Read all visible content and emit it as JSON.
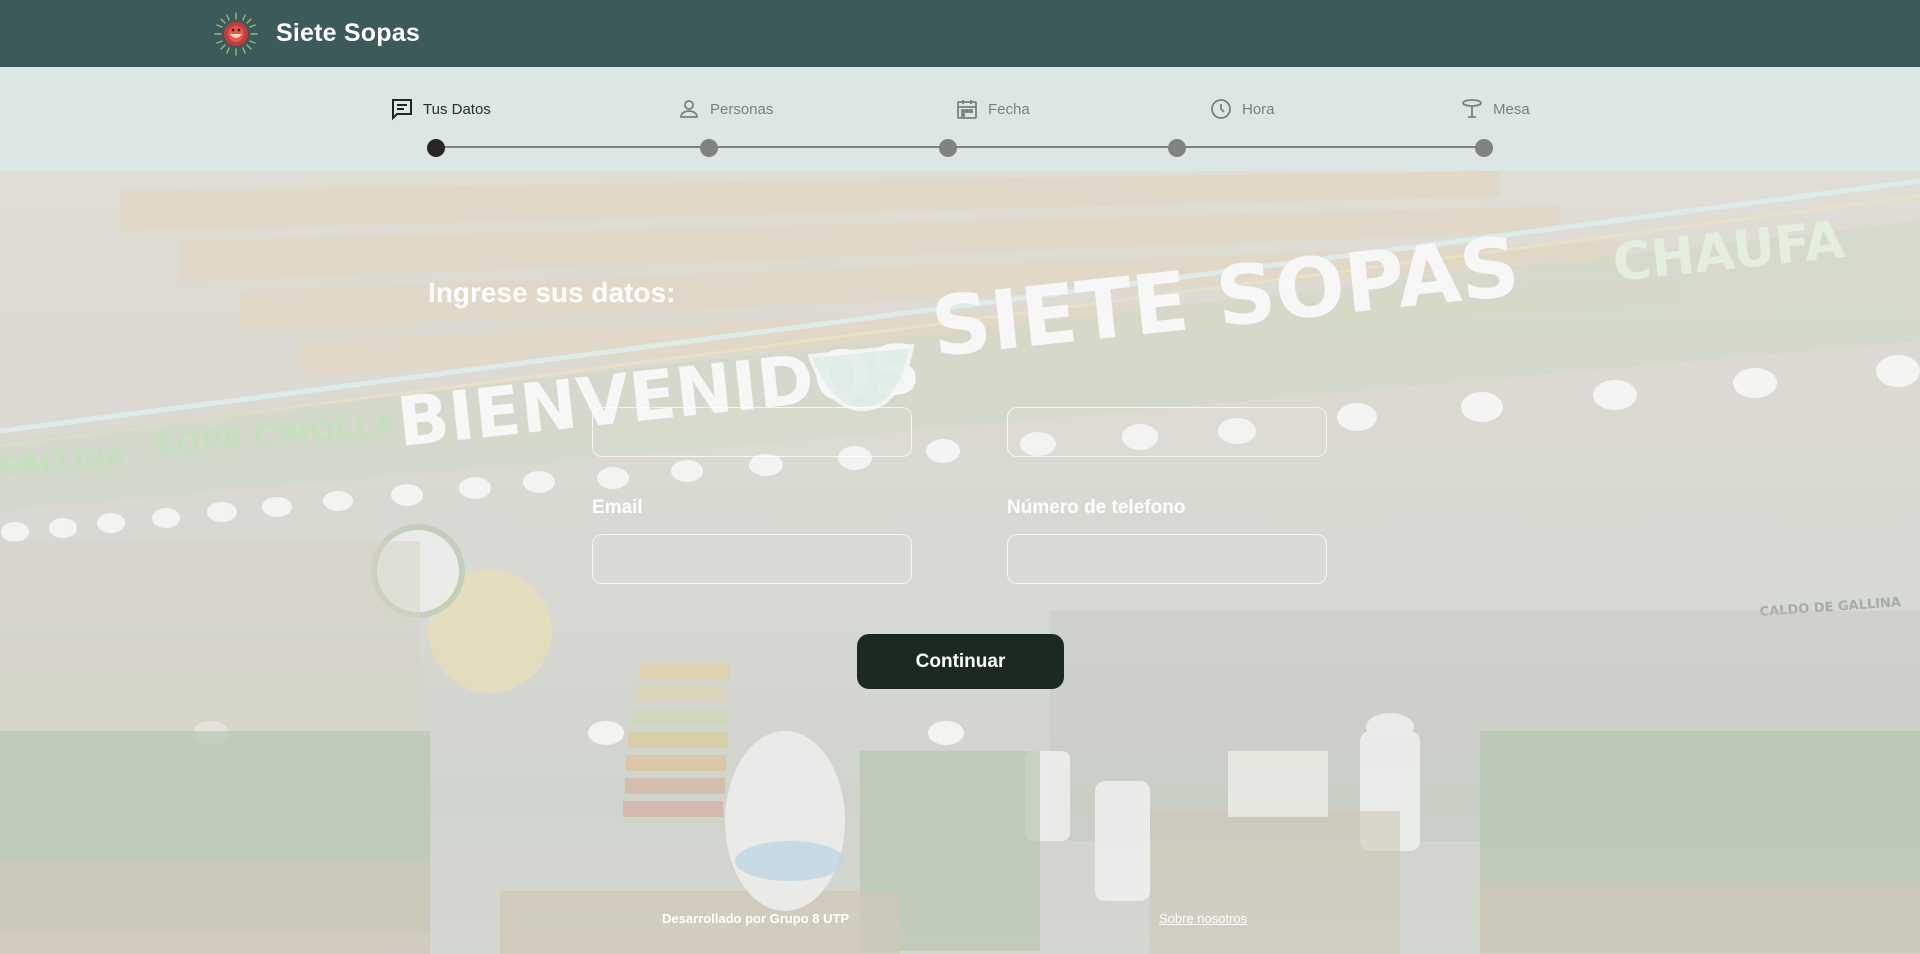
{
  "header": {
    "brand_name": "Siete Sopas",
    "logo_icon": "siete-sopas-logo-icon",
    "background_color": "#3c5a59"
  },
  "stepper": {
    "background_color": "#dce6e5",
    "steps": [
      {
        "label": "Tus Datos",
        "icon": "chat-icon",
        "active": true
      },
      {
        "label": "Personas",
        "icon": "person-icon",
        "active": false
      },
      {
        "label": "Fecha",
        "icon": "calendar-icon",
        "active": false
      },
      {
        "label": "Hora",
        "icon": "clock-icon",
        "active": false
      },
      {
        "label": "Mesa",
        "icon": "table-icon",
        "active": false
      }
    ],
    "current_step": 1
  },
  "hero": {
    "background_scene": {
      "signage": [
        "BIENVENIDOS",
        "SIETE SOPAS",
        "CHAUFA",
        "SOPA CRIOLLA",
        "GALLINA",
        "CALDO DE GALLINA"
      ]
    }
  },
  "form": {
    "title": "Ingrese sus datos:",
    "fields": {
      "email": {
        "label": "Email",
        "value": "",
        "placeholder": ""
      },
      "phone": {
        "label": "Número de telefono",
        "value": "",
        "placeholder": ""
      },
      "name": {
        "value": "",
        "placeholder": ""
      },
      "dni": {
        "value": "",
        "placeholder": ""
      }
    },
    "submit_label": "Continuar",
    "submit_color": "#1b2a20"
  },
  "footer": {
    "credit": "Desarrollado por Grupo 8 UTP",
    "about_link": "Sobre nosotros"
  }
}
